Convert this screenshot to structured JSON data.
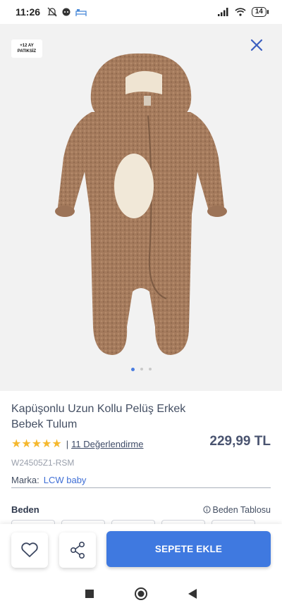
{
  "status_bar": {
    "time": "11:26",
    "battery": "14"
  },
  "gallery": {
    "badge_line1": "+12 AY",
    "badge_line2": "PATIKSİZ",
    "dots": 3,
    "active_dot": 0
  },
  "product": {
    "title": "Kapüşonlu Uzun Kollu Pelüş Erkek Bebek Tulum",
    "stars": "★★★★★",
    "rating_separator": "|",
    "reviews_label": "11 Değerlendirme",
    "price": "229,99 TL",
    "sku": "W24505Z1-RSM",
    "brand_label": "Marka:",
    "brand_value": "LCW baby"
  },
  "size": {
    "label": "Beden",
    "table_label": "Beden Tablosu"
  },
  "actions": {
    "add_to_cart": "SEPETE EKLE"
  },
  "colors": {
    "accent": "#3f79e0",
    "star": "#f5b82e",
    "link": "#3f6fd6"
  }
}
